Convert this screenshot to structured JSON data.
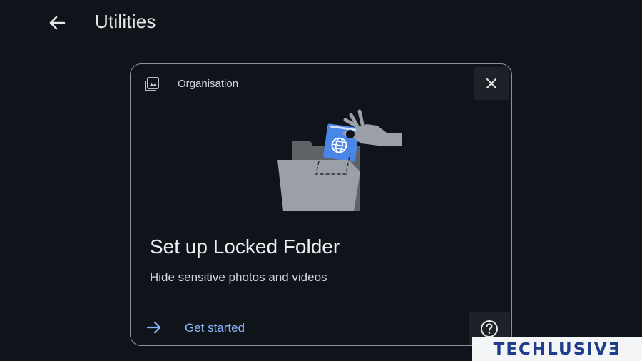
{
  "header": {
    "title": "Utilities",
    "back_icon": "arrow-back-icon"
  },
  "card": {
    "category": "Organisation",
    "category_icon": "photo-library-icon",
    "close_icon": "close-icon",
    "heading": "Set up Locked Folder",
    "subtitle": "Hide sensitive photos and videos",
    "action_label": "Get started",
    "action_icon": "arrow-forward-icon",
    "help_icon": "help-circle-icon",
    "illustration": "hand-placing-passport-into-folder-illustration"
  },
  "watermark": {
    "text": "TECHLUSIVƎ"
  },
  "colors": {
    "background": "#0f141b",
    "card_border": "#8e9196",
    "link": "#8ab4f8",
    "passport_blue": "#4a86e8",
    "illustration_gray": "#9aa0a6",
    "watermark_text": "#1f3d8a"
  }
}
